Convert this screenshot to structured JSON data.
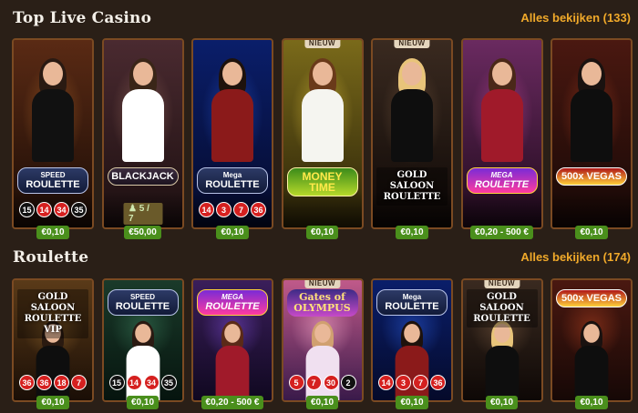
{
  "sections": [
    {
      "title": "Top Live Casino",
      "see_all": "Alles bekijken (133)",
      "cards": [
        {
          "name": "speed-roulette",
          "logo": "ROULETTE",
          "logo_pre": "SPEED",
          "logo_style": "roulette",
          "bg": "#5a2a14",
          "bg2": "#1a0c06",
          "torso": "#111111",
          "hair": "#2a1a12",
          "glow": "#b46a2a",
          "new": false,
          "numbers": [
            [
              "15",
              "black"
            ],
            [
              "14",
              "red"
            ],
            [
              "34",
              "red"
            ],
            [
              "35",
              "black"
            ]
          ],
          "bet": "€0,10"
        },
        {
          "name": "blackjack",
          "logo": "BLACKJACK",
          "logo_pre": "",
          "logo_style": "bj",
          "bg": "#4a2a30",
          "bg2": "#1c0f10",
          "torso": "#ffffff",
          "hair": "#3a2618",
          "glow": "#a07060",
          "new": false,
          "seats": "♟ 5 / 7",
          "bet": "€50,00"
        },
        {
          "name": "mega-roulette-500x",
          "logo": "ROULETTE",
          "logo_pre": "Mega",
          "logo_style": "roulette",
          "bg": "#0a1e6a",
          "bg2": "#050a2a",
          "torso": "#8b1a1a",
          "hair": "#1e120c",
          "glow": "#2a5ad6",
          "new": false,
          "numbers": [
            [
              "14",
              "red"
            ],
            [
              "3",
              "red"
            ],
            [
              "7",
              "red"
            ],
            [
              "36",
              "red"
            ]
          ],
          "bet": "€0,10"
        },
        {
          "name": "money-time",
          "logo": "MONEY TIME",
          "logo_pre": "",
          "logo_style": "money",
          "bg": "#7a6a1a",
          "bg2": "#2a2208",
          "torso": "#f5f5f0",
          "hair": "#6a3a1a",
          "glow": "#f0d040",
          "new": true,
          "new_label": "NIEUW",
          "bet": "€0,10"
        },
        {
          "name": "gold-saloon-roulette",
          "logo": "GOLD SALOON ROULETTE",
          "logo_pre": "",
          "logo_style": "gold",
          "bg": "#3a2a20",
          "bg2": "#0e0806",
          "torso": "#0e0e0e",
          "hair": "#e8c47a",
          "glow": "#7a5a40",
          "new": true,
          "new_label": "NIEUW",
          "bet": "€0,10"
        },
        {
          "name": "mega-fire-blaze-roulette",
          "logo": "ROULETTE",
          "logo_pre": "MEGA",
          "logo_style": "mega",
          "bg": "#6a2a60",
          "bg2": "#200a1c",
          "torso": "#a01a2a",
          "hair": "#4a2818",
          "glow": "#d04aa0",
          "new": false,
          "bet": "€0,20 - 500 €"
        },
        {
          "name": "500x-vegas-roulette",
          "logo": "500x VEGAS",
          "logo_pre": "",
          "logo_style": "vegas",
          "bg": "#4a1810",
          "bg2": "#160806",
          "torso": "#0e0e0e",
          "hair": "#1a1210",
          "glow": "#b04020",
          "new": false,
          "bet": "€0,10"
        }
      ]
    },
    {
      "title": "Roulette",
      "see_all": "Alles bekijken (174)",
      "cards": [
        {
          "name": "gold-saloon-roulette-vip",
          "logo": "GOLD SALOON ROULETTE VIP",
          "logo_pre": "",
          "logo_style": "gold",
          "bg": "#5a3a18",
          "bg2": "#1a0e06",
          "torso": "#0e0e0e",
          "hair": "#2a1a10",
          "glow": "#a07030",
          "new": false,
          "numbers": [
            [
              "36",
              "red"
            ],
            [
              "36",
              "red"
            ],
            [
              "18",
              "red"
            ],
            [
              "7",
              "red"
            ]
          ],
          "bet": "€0,10"
        },
        {
          "name": "speed-roulette-2",
          "logo": "ROULETTE",
          "logo_pre": "SPEED",
          "logo_style": "roulette",
          "bg": "#1a3a2a",
          "bg2": "#06140e",
          "torso": "#ffffff",
          "hair": "#2a1a12",
          "glow": "#3a7a5a",
          "new": false,
          "numbers": [
            [
              "15",
              "black"
            ],
            [
              "14",
              "red"
            ],
            [
              "34",
              "red"
            ],
            [
              "35",
              "black"
            ]
          ],
          "bet": "€0,10"
        },
        {
          "name": "mega-roulette-live",
          "logo": "ROULETTE",
          "logo_pre": "MEGA",
          "logo_style": "mega",
          "bg": "#3a1e5a",
          "bg2": "#100820",
          "torso": "#a01a2a",
          "hair": "#5a2a18",
          "glow": "#7a4ad0",
          "new": false,
          "bet": "€0,20 - 500 €"
        },
        {
          "name": "gates-of-olympus-roulette",
          "logo": "Gates of OLYMPUS",
          "logo_pre": "",
          "logo_style": "olympus",
          "bg": "#c05a8a",
          "bg2": "#3a1a4a",
          "torso": "#f0e0f0",
          "hair": "#d0a070",
          "glow": "#ffb0d0",
          "new": true,
          "new_label": "NIEUW",
          "numbers": [
            [
              "5",
              "red"
            ],
            [
              "7",
              "red"
            ],
            [
              "30",
              "red"
            ],
            [
              "2",
              "black"
            ]
          ],
          "bet": "€0,10"
        },
        {
          "name": "mega-roulette-500x-2",
          "logo": "ROULETTE",
          "logo_pre": "Mega",
          "logo_style": "roulette",
          "bg": "#0a1e6a",
          "bg2": "#050a2a",
          "torso": "#8b1a1a",
          "hair": "#1e120c",
          "glow": "#2a5ad6",
          "new": false,
          "numbers": [
            [
              "14",
              "red"
            ],
            [
              "3",
              "red"
            ],
            [
              "7",
              "red"
            ],
            [
              "36",
              "red"
            ]
          ],
          "bet": "€0,10"
        },
        {
          "name": "gold-saloon-roulette-2",
          "logo": "GOLD SALOON ROULETTE",
          "logo_pre": "",
          "logo_style": "gold",
          "bg": "#3a2a20",
          "bg2": "#0e0806",
          "torso": "#0e0e0e",
          "hair": "#e8c47a",
          "glow": "#7a5a40",
          "new": true,
          "new_label": "NIEUW",
          "bet": "€0,10"
        },
        {
          "name": "500x-vegas-roulette-2",
          "logo": "500x VEGAS",
          "logo_pre": "",
          "logo_style": "vegas",
          "bg": "#4a1810",
          "bg2": "#160806",
          "torso": "#0e0e0e",
          "hair": "#1a1210",
          "glow": "#b04020",
          "new": false,
          "bet": "€0,10"
        }
      ]
    }
  ]
}
